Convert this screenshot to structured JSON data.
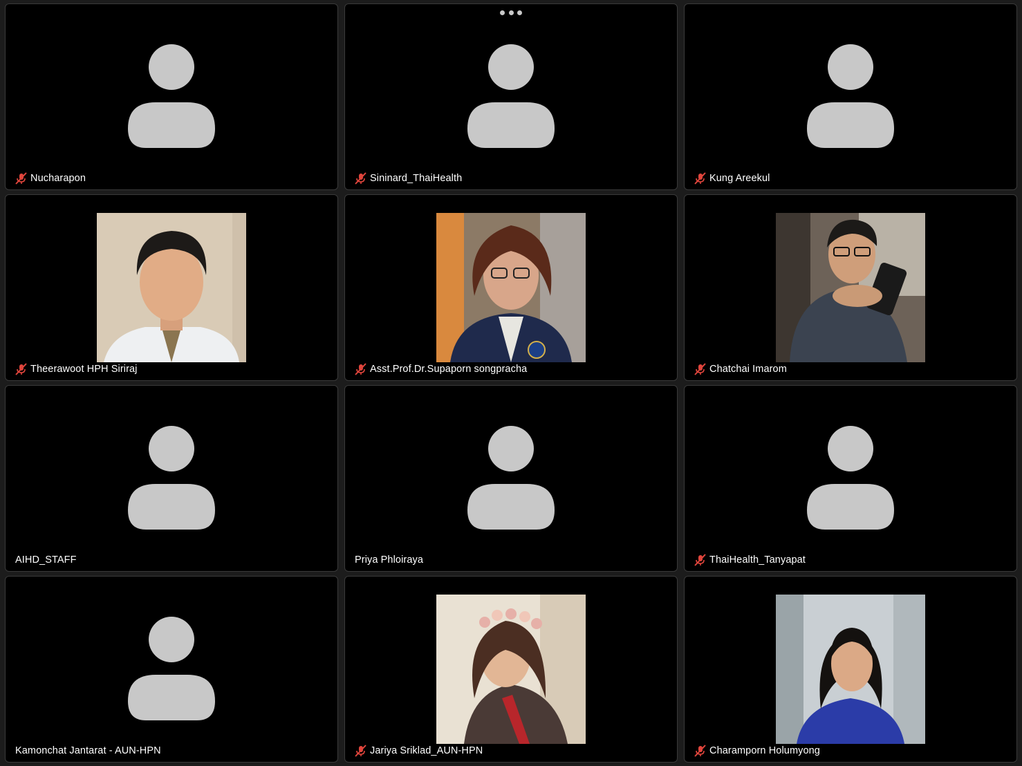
{
  "colors": {
    "background": "#1c1c1c",
    "tile": "#000000",
    "avatar": "#c8c8c8",
    "muted_icon": "#e0453c",
    "name_text": "#ffffff"
  },
  "participants": [
    {
      "name": "Nucharapon",
      "muted": true,
      "video": false
    },
    {
      "name": "Sininard_ThaiHealth",
      "muted": true,
      "video": false,
      "more_menu_icon": "more-dots-icon"
    },
    {
      "name": "Kung Areekul",
      "muted": true,
      "video": false
    },
    {
      "name": "Theerawoot HPH Siriraj",
      "muted": true,
      "video": true
    },
    {
      "name": "Asst.Prof.Dr.Supaporn songpracha",
      "muted": true,
      "video": true
    },
    {
      "name": "Chatchai Imarom",
      "muted": true,
      "video": true
    },
    {
      "name": "AIHD_STAFF",
      "muted": false,
      "video": false
    },
    {
      "name": "Priya Phloiraya",
      "muted": false,
      "video": false
    },
    {
      "name": "ThaiHealth_Tanyapat",
      "muted": true,
      "video": false
    },
    {
      "name": "Kamonchat Jantarat - AUN-HPN",
      "muted": false,
      "video": false
    },
    {
      "name": "Jariya Sriklad_AUN-HPN",
      "muted": true,
      "video": true
    },
    {
      "name": "Charamporn Holumyong",
      "muted": true,
      "video": true
    }
  ]
}
